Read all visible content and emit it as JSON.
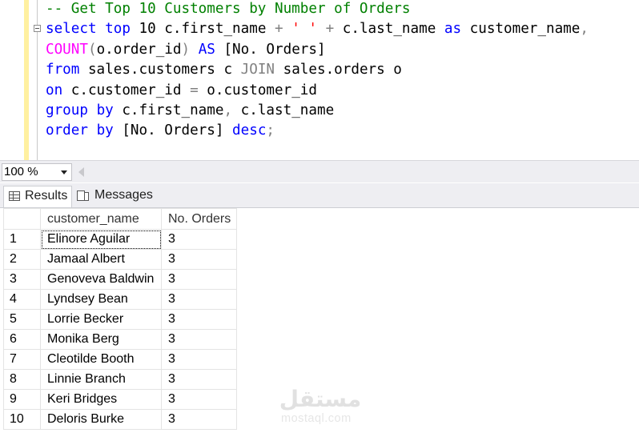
{
  "editor": {
    "lines": [
      {
        "parts": [
          {
            "cls": "cm",
            "t": "-- Get Top 10 Customers by Number of Orders"
          }
        ]
      },
      {
        "parts": [
          {
            "cls": "kw",
            "t": "select"
          },
          {
            "cls": "",
            "t": " "
          },
          {
            "cls": "kw",
            "t": "top"
          },
          {
            "cls": "",
            "t": " 10 c.first_name "
          },
          {
            "cls": "gr",
            "t": "+"
          },
          {
            "cls": "",
            "t": " "
          },
          {
            "cls": "str",
            "t": "' '"
          },
          {
            "cls": "",
            "t": " "
          },
          {
            "cls": "gr",
            "t": "+"
          },
          {
            "cls": "",
            "t": " c.last_name "
          },
          {
            "cls": "kw",
            "t": "as"
          },
          {
            "cls": "",
            "t": " customer_name"
          },
          {
            "cls": "gr",
            "t": ","
          }
        ]
      },
      {
        "parts": [
          {
            "cls": "fn",
            "t": "COUNT"
          },
          {
            "cls": "gr",
            "t": "("
          },
          {
            "cls": "",
            "t": "o.order_id"
          },
          {
            "cls": "gr",
            "t": ")"
          },
          {
            "cls": "",
            "t": " "
          },
          {
            "cls": "kw",
            "t": "AS"
          },
          {
            "cls": "",
            "t": " [No. Orders]"
          }
        ]
      },
      {
        "parts": [
          {
            "cls": "kw",
            "t": "from"
          },
          {
            "cls": "",
            "t": " sales.customers c "
          },
          {
            "cls": "gr",
            "t": "JOIN"
          },
          {
            "cls": "",
            "t": " sales.orders o"
          }
        ]
      },
      {
        "parts": [
          {
            "cls": "kw",
            "t": "on"
          },
          {
            "cls": "",
            "t": " c.customer_id "
          },
          {
            "cls": "gr",
            "t": "="
          },
          {
            "cls": "",
            "t": " o.customer_id"
          }
        ]
      },
      {
        "parts": [
          {
            "cls": "kw",
            "t": "group"
          },
          {
            "cls": "",
            "t": " "
          },
          {
            "cls": "kw",
            "t": "by"
          },
          {
            "cls": "",
            "t": " c.first_name"
          },
          {
            "cls": "gr",
            "t": ","
          },
          {
            "cls": "",
            "t": " c.last_name"
          }
        ]
      },
      {
        "parts": [
          {
            "cls": "kw",
            "t": "order"
          },
          {
            "cls": "",
            "t": " "
          },
          {
            "cls": "kw",
            "t": "by"
          },
          {
            "cls": "",
            "t": " [No. Orders] "
          },
          {
            "cls": "kw",
            "t": "desc"
          },
          {
            "cls": "gr",
            "t": ";"
          }
        ]
      }
    ]
  },
  "toolbar": {
    "zoom_value": "100 %"
  },
  "tabs": {
    "results_label": "Results",
    "messages_label": "Messages"
  },
  "grid": {
    "columns": [
      "customer_name",
      "No. Orders"
    ],
    "rows": [
      {
        "n": "1",
        "name": "Elinore Aguilar",
        "orders": "3"
      },
      {
        "n": "2",
        "name": "Jamaal Albert",
        "orders": "3"
      },
      {
        "n": "3",
        "name": "Genoveva Baldwin",
        "orders": "3"
      },
      {
        "n": "4",
        "name": "Lyndsey Bean",
        "orders": "3"
      },
      {
        "n": "5",
        "name": "Lorrie Becker",
        "orders": "3"
      },
      {
        "n": "6",
        "name": "Monika Berg",
        "orders": "3"
      },
      {
        "n": "7",
        "name": "Cleotilde Booth",
        "orders": "3"
      },
      {
        "n": "8",
        "name": "Linnie Branch",
        "orders": "3"
      },
      {
        "n": "9",
        "name": "Keri Bridges",
        "orders": "3"
      },
      {
        "n": "10",
        "name": "Deloris Burke",
        "orders": "3"
      }
    ]
  },
  "watermark": {
    "logo_text": "مستقل",
    "text": "mostaql.com"
  },
  "colors": {
    "keyword": "#0000ff",
    "function": "#ff00ff",
    "comment": "#008000",
    "string": "#ff0000",
    "operator": "#808080"
  }
}
